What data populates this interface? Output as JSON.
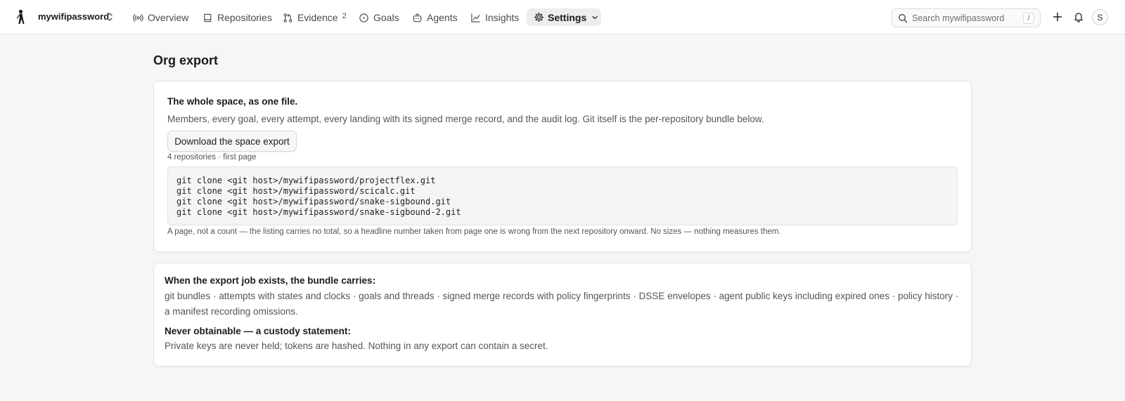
{
  "org": {
    "name": "mywifipassword"
  },
  "nav": {
    "overview": "Overview",
    "repositories": "Repositories",
    "evidence": "Evidence",
    "evidence_count": "2",
    "goals": "Goals",
    "agents": "Agents",
    "insights": "Insights",
    "settings": "Settings"
  },
  "search": {
    "placeholder": "Search mywifipassword",
    "shortcut": "/"
  },
  "user": {
    "initial": "S"
  },
  "page": {
    "title": "Org export"
  },
  "export_card": {
    "heading": "The whole space, as one file.",
    "description": "Members, every goal, every attempt, every landing with its signed merge record, and the audit log. Git itself is the per-repository bundle below.",
    "download_label": "Download the space export",
    "repo_meta": "4 repositories · first page",
    "clone_lines": [
      "git clone <git host>/mywifipassword/projectflex.git",
      "git clone <git host>/mywifipassword/scicalc.git",
      "git clone <git host>/mywifipassword/snake-sigbound.git",
      "git clone <git host>/mywifipassword/snake-sigbound-2.git"
    ],
    "note": "A page, not a count — the listing carries no total, so a headline number taken from page one is wrong from the next repository onward. No sizes — nothing measures them."
  },
  "bundle_card": {
    "carries_heading": "When the export job exists, the bundle carries:",
    "carries_text": "git bundles · attempts with states and clocks · goals and threads · signed merge records with policy fingerprints · DSSE envelopes · agent public keys including expired ones · policy history · a manifest recording omissions.",
    "custody_heading": "Never obtainable — a custody statement:",
    "custody_text": "Private keys are never held; tokens are hashed. Nothing in any export can contain a secret."
  }
}
